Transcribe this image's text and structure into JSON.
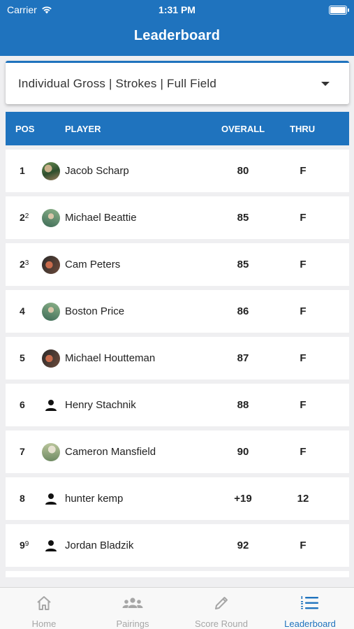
{
  "status_bar": {
    "carrier": "Carrier",
    "time": "1:31 PM"
  },
  "header": {
    "title": "Leaderboard"
  },
  "filter": {
    "label": "Individual Gross | Strokes | Full Field"
  },
  "table": {
    "columns": {
      "pos": "POS",
      "player": "PLAYER",
      "overall": "OVERALL",
      "thru": "THRU"
    },
    "rows": [
      {
        "pos": "1",
        "tie": "",
        "name": "Jacob Scharp",
        "overall": "80",
        "thru": "F",
        "avatar": "photo"
      },
      {
        "pos": "2",
        "tie": "2",
        "name": "Michael Beattie",
        "overall": "85",
        "thru": "F",
        "avatar": "photo"
      },
      {
        "pos": "2",
        "tie": "3",
        "name": "Cam Peters",
        "overall": "85",
        "thru": "F",
        "avatar": "photo"
      },
      {
        "pos": "4",
        "tie": "",
        "name": "Boston Price",
        "overall": "86",
        "thru": "F",
        "avatar": "photo"
      },
      {
        "pos": "5",
        "tie": "",
        "name": "Michael Houtteman",
        "overall": "87",
        "thru": "F",
        "avatar": "photo"
      },
      {
        "pos": "6",
        "tie": "",
        "name": "Henry Stachnik",
        "overall": "88",
        "thru": "F",
        "avatar": "person-icon"
      },
      {
        "pos": "7",
        "tie": "",
        "name": "Cameron Mansfield",
        "overall": "90",
        "thru": "F",
        "avatar": "photo"
      },
      {
        "pos": "8",
        "tie": "",
        "name": "hunter kemp",
        "overall": "+19",
        "thru": "12",
        "avatar": "person-icon"
      },
      {
        "pos": "9",
        "tie": "9",
        "name": "Jordan Bladzik",
        "overall": "92",
        "thru": "F",
        "avatar": "person-icon"
      }
    ]
  },
  "tabbar": {
    "tabs": [
      {
        "label": "Home",
        "icon": "home-icon",
        "active": false
      },
      {
        "label": "Pairings",
        "icon": "group-icon",
        "active": false
      },
      {
        "label": "Score Round",
        "icon": "pencil-icon",
        "active": false
      },
      {
        "label": "Leaderboard",
        "icon": "list-numbered-icon",
        "active": true
      }
    ]
  },
  "colors": {
    "primary": "#1f73be",
    "background": "#efeff1",
    "inactive_tab": "#a6a6a6"
  }
}
